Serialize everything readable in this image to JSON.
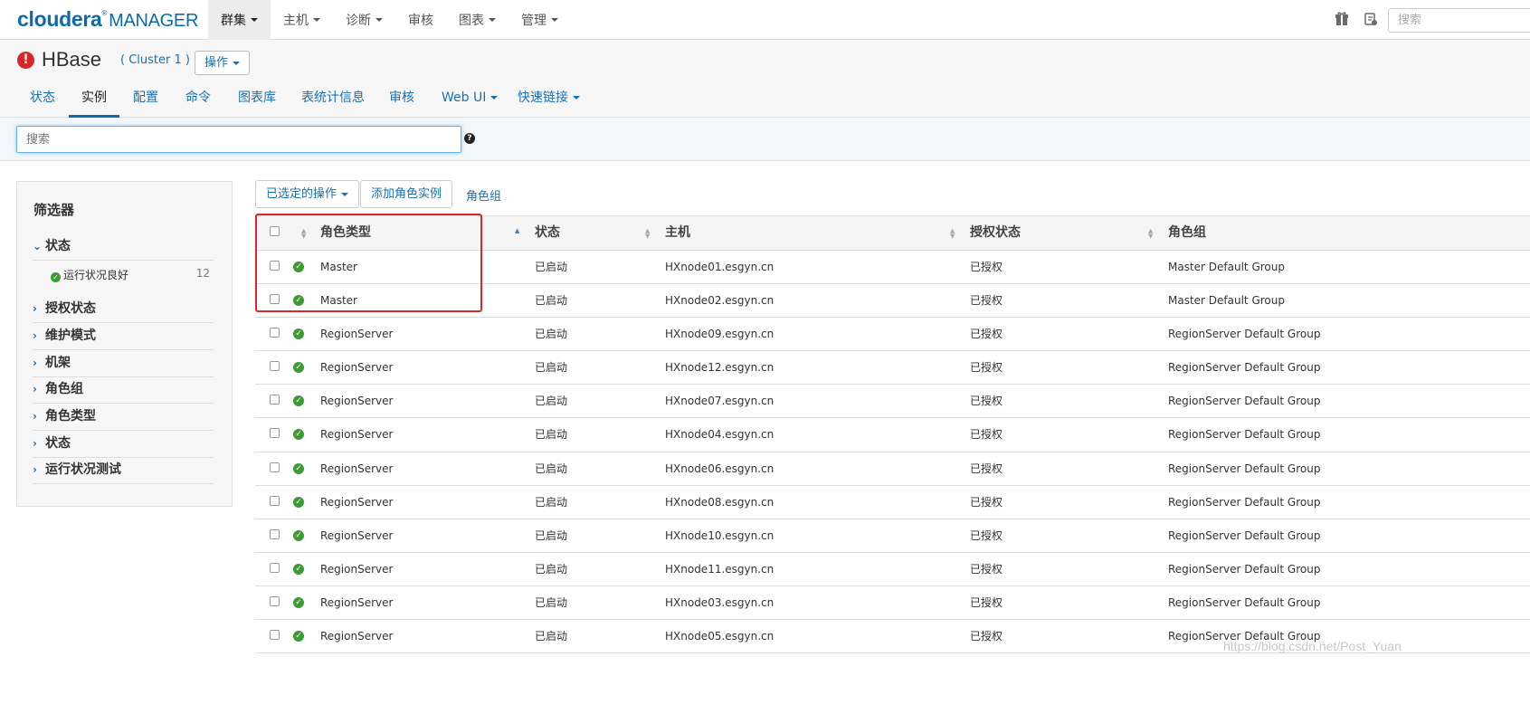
{
  "brand": {
    "name": "cloudera",
    "product": "MANAGER",
    "accent": "#0e6aa8"
  },
  "topnav": [
    {
      "label": "群集",
      "dropdown": true,
      "active": true
    },
    {
      "label": "主机",
      "dropdown": true
    },
    {
      "label": "诊断",
      "dropdown": true
    },
    {
      "label": "审核",
      "dropdown": false
    },
    {
      "label": "图表",
      "dropdown": true
    },
    {
      "label": "管理",
      "dropdown": true
    }
  ],
  "top_icons": [
    "parcel-icon",
    "running-commands-icon"
  ],
  "top_search": {
    "placeholder": "搜索"
  },
  "service": {
    "name": "HBase",
    "status_icon": "error-icon",
    "status_color": "#d9262b",
    "cluster_label": "( Cluster 1 )",
    "actions_label": "操作"
  },
  "subtabs": [
    {
      "label": "状态"
    },
    {
      "label": "实例",
      "active": true
    },
    {
      "label": "配置"
    },
    {
      "label": "命令"
    },
    {
      "label": "图表库"
    },
    {
      "label": "表统计信息"
    },
    {
      "label": "审核"
    },
    {
      "label": "Web UI",
      "dropdown": true
    },
    {
      "label": "快速链接",
      "dropdown": true
    }
  ],
  "search": {
    "placeholder": "搜索"
  },
  "filters": {
    "title": "筛选器",
    "groups": [
      {
        "label": "状态",
        "expanded": true,
        "items": [
          {
            "label": "运行状况良好",
            "count": "12"
          }
        ]
      },
      {
        "label": "授权状态"
      },
      {
        "label": "维护模式"
      },
      {
        "label": "机架"
      },
      {
        "label": "角色组"
      },
      {
        "label": "角色类型"
      },
      {
        "label": "状态"
      },
      {
        "label": "运行状况测试"
      }
    ]
  },
  "actions": {
    "selected_ops": "已选定的操作",
    "add_role_instance": "添加角色实例",
    "role_groups": "角色组"
  },
  "table": {
    "columns": [
      "角色类型",
      "状态",
      "主机",
      "授权状态",
      "角色组"
    ],
    "sorted_column": "角色类型",
    "rows": [
      {
        "role": "Master",
        "state": "已启动",
        "host": "HXnode01.esgyn.cn",
        "commission": "已授权",
        "group": "Master Default Group"
      },
      {
        "role": "Master",
        "state": "已启动",
        "host": "HXnode02.esgyn.cn",
        "commission": "已授权",
        "group": "Master Default Group"
      },
      {
        "role": "RegionServer",
        "state": "已启动",
        "host": "HXnode09.esgyn.cn",
        "commission": "已授权",
        "group": "RegionServer Default Group"
      },
      {
        "role": "RegionServer",
        "state": "已启动",
        "host": "HXnode12.esgyn.cn",
        "commission": "已授权",
        "group": "RegionServer Default Group"
      },
      {
        "role": "RegionServer",
        "state": "已启动",
        "host": "HXnode07.esgyn.cn",
        "commission": "已授权",
        "group": "RegionServer Default Group"
      },
      {
        "role": "RegionServer",
        "state": "已启动",
        "host": "HXnode04.esgyn.cn",
        "commission": "已授权",
        "group": "RegionServer Default Group"
      },
      {
        "role": "RegionServer",
        "state": "已启动",
        "host": "HXnode06.esgyn.cn",
        "commission": "已授权",
        "group": "RegionServer Default Group"
      },
      {
        "role": "RegionServer",
        "state": "已启动",
        "host": "HXnode08.esgyn.cn",
        "commission": "已授权",
        "group": "RegionServer Default Group"
      },
      {
        "role": "RegionServer",
        "state": "已启动",
        "host": "HXnode10.esgyn.cn",
        "commission": "已授权",
        "group": "RegionServer Default Group"
      },
      {
        "role": "RegionServer",
        "state": "已启动",
        "host": "HXnode11.esgyn.cn",
        "commission": "已授权",
        "group": "RegionServer Default Group"
      },
      {
        "role": "RegionServer",
        "state": "已启动",
        "host": "HXnode03.esgyn.cn",
        "commission": "已授权",
        "group": "RegionServer Default Group"
      },
      {
        "role": "RegionServer",
        "state": "已启动",
        "host": "HXnode05.esgyn.cn",
        "commission": "已授权",
        "group": "RegionServer Default Group"
      }
    ]
  },
  "annotation": {
    "color": "#e0262a"
  },
  "watermark": "https://blog.csdn.net/Post_Yuan"
}
